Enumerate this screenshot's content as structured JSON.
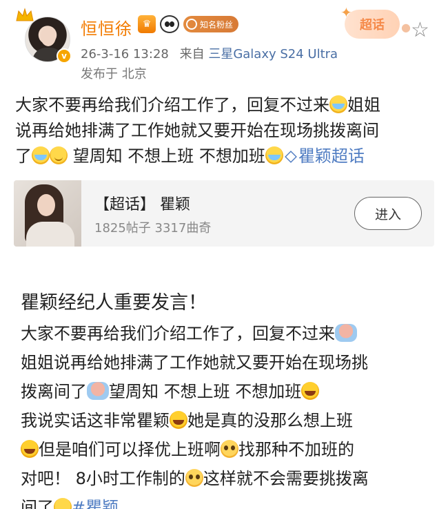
{
  "header": {
    "username": "恒恒徐",
    "fans_badge": "知名粉丝",
    "level_badge": "♛",
    "verified_mark": "v",
    "timestamp": "26-3-16 13:28",
    "source_prefix": "来自",
    "device": "三星Galaxy S24 Ultra",
    "location": "发布于 北京",
    "chaohua_tag": "超话",
    "icons": [
      "crown-icon",
      "verified-icon",
      "level-badge-icon",
      "panda-icon",
      "fans-badge-icon",
      "star-icon"
    ]
  },
  "post": {
    "line1": "大家不要再给我们介绍工作了，回复不过来",
    "line1b": "姐姐",
    "line2": "说再给她排满了工作她就又要开始在现场挑拨离间",
    "line3a": "了",
    "line3b": " 望周知 不想上班 不想加班",
    "topic": "瞿颖超话"
  },
  "card": {
    "title": "【超话】 瞿颖",
    "stats": "1825帖子 3317曲奇",
    "enter_label": "进入"
  },
  "repost": {
    "headline": "瞿颖经纪人重要发言！",
    "l1": "大家不要再给我们介绍工作了，回复不过来",
    "l2": "姐姐说再给她排满了工作她就又要开始在现场挑",
    "l3a": "拨离间了",
    "l3b": "望周知 不想上班 不想加班",
    "l4a": "我说实话这非常瞿颖",
    "l4b": "她是真的没那么想上班",
    "l5a": "但是咱们可以择优上班啊",
    "l5b": "找那种不加班的",
    "l6a": "对吧！ 8小时工作制的",
    "l6b": "这样就不会需要挑拨离",
    "l7a": "间了",
    "l7b": "#瞿颖"
  },
  "colors": {
    "username": "#f27b00",
    "link": "#4f7cc2",
    "device": "#4a6fa5",
    "card_bg": "#f4f4f4"
  }
}
